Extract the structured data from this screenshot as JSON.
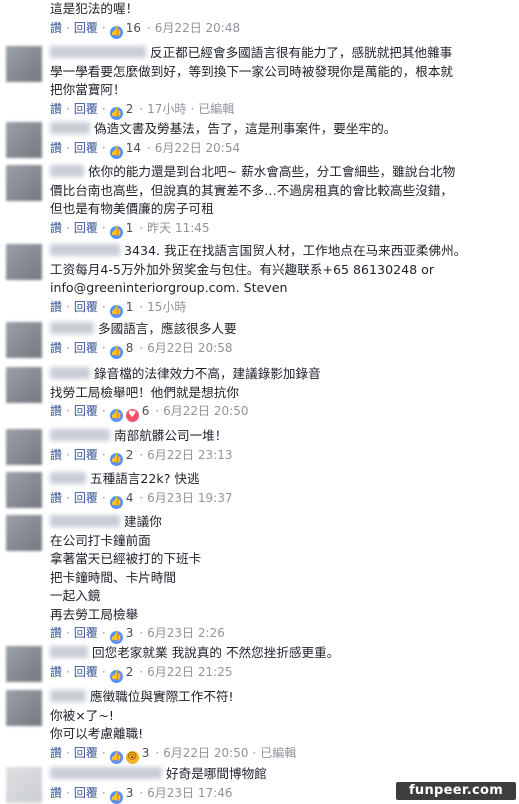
{
  "actions": {
    "like": "讚",
    "reply": "回覆",
    "edited": "已編輯"
  },
  "comments": [
    {
      "lines": [
        "這是犯法的喔！"
      ],
      "reactions": [
        "like"
      ],
      "count": "16",
      "time": "6月22日 20:48",
      "edited": false
    },
    {
      "lines": [
        "反正都已經會多國語言很有能力了，感胱就把其他雜事",
        "學一學看要怎麼做到好，等到換下一家公司時被發現你是萬能的，根本就",
        "把你當寶阿！"
      ],
      "reactions": [
        "like"
      ],
      "count": "2",
      "time": "17小時",
      "edited": true
    },
    {
      "lines": [
        "偽造文書及勞基法，告了，這是刑事案件，要坐牢的。"
      ],
      "reactions": [
        "like"
      ],
      "count": "14",
      "time": "6月22日 20:54",
      "edited": false
    },
    {
      "lines": [
        "依你的能力還是到台北吧~ 薪水會高些，分工會細些，雖說台北物",
        "價比台南也高些，但說真的其實差不多…不過房租真的會比較高些沒錯，",
        "但也是有物美價廉的房子可租"
      ],
      "reactions": [
        "like"
      ],
      "count": "1",
      "time": "昨天 11:45",
      "edited": false
    },
    {
      "lines": [
        "3434. 我正在找語言国贸人材，工作地点在马来西亚柔佛州。",
        "工资每月4-5万外加外贸奖金与包住。有兴趣联系+65 86130248 or",
        "info@greeninteriorgroup.com. Steven"
      ],
      "reactions": [
        "like"
      ],
      "count": "1",
      "time": "15小時",
      "edited": false
    },
    {
      "lines": [
        "多國語言，應該很多人要"
      ],
      "reactions": [
        "like"
      ],
      "count": "8",
      "time": "6月22日 20:58",
      "edited": false
    },
    {
      "lines": [
        "錄音檔的法律效力不高，建議錄影加錄音",
        "找勞工局檢舉吧！他們就是想抗你"
      ],
      "reactions": [
        "like",
        "love"
      ],
      "count": "6",
      "time": "6月22日 20:50",
      "edited": false
    },
    {
      "lines": [
        "南部航髒公司一堆！"
      ],
      "reactions": [
        "like"
      ],
      "count": "2",
      "time": "6月22日 23:13",
      "edited": false
    },
    {
      "lines": [
        "五種語言22k? 快逃"
      ],
      "reactions": [
        "like"
      ],
      "count": "4",
      "time": "6月23日 19:37",
      "edited": false
    },
    {
      "lines": [
        "建議你",
        "在公司打卡鐘前面",
        "拿著當天已經被打的下班卡",
        "把卡鐘時間、卡片時間",
        "一起入鏡",
        "再去勞工局檢舉"
      ],
      "reactions": [
        "like"
      ],
      "count": "3",
      "time": "6月23日 2:26",
      "edited": false
    },
    {
      "lines": [
        "回您老家就業 我說真的 不然您挫折感更重。"
      ],
      "reactions": [
        "like"
      ],
      "count": "2",
      "time": "6月22日 21:25",
      "edited": false
    },
    {
      "lines": [
        "應徵職位與實際工作不符!",
        "你被×了~!",
        "你可以考慮離職!"
      ],
      "reactions": [
        "like",
        "wow"
      ],
      "count": "3",
      "time": "6月22日 20:50",
      "edited": true
    },
    {
      "lines": [
        "好奇是哪間博物館"
      ],
      "reactions": [
        "like"
      ],
      "count": "3",
      "time": "6月23日 17:46",
      "edited": false
    }
  ],
  "watermark": "funpeer.com"
}
